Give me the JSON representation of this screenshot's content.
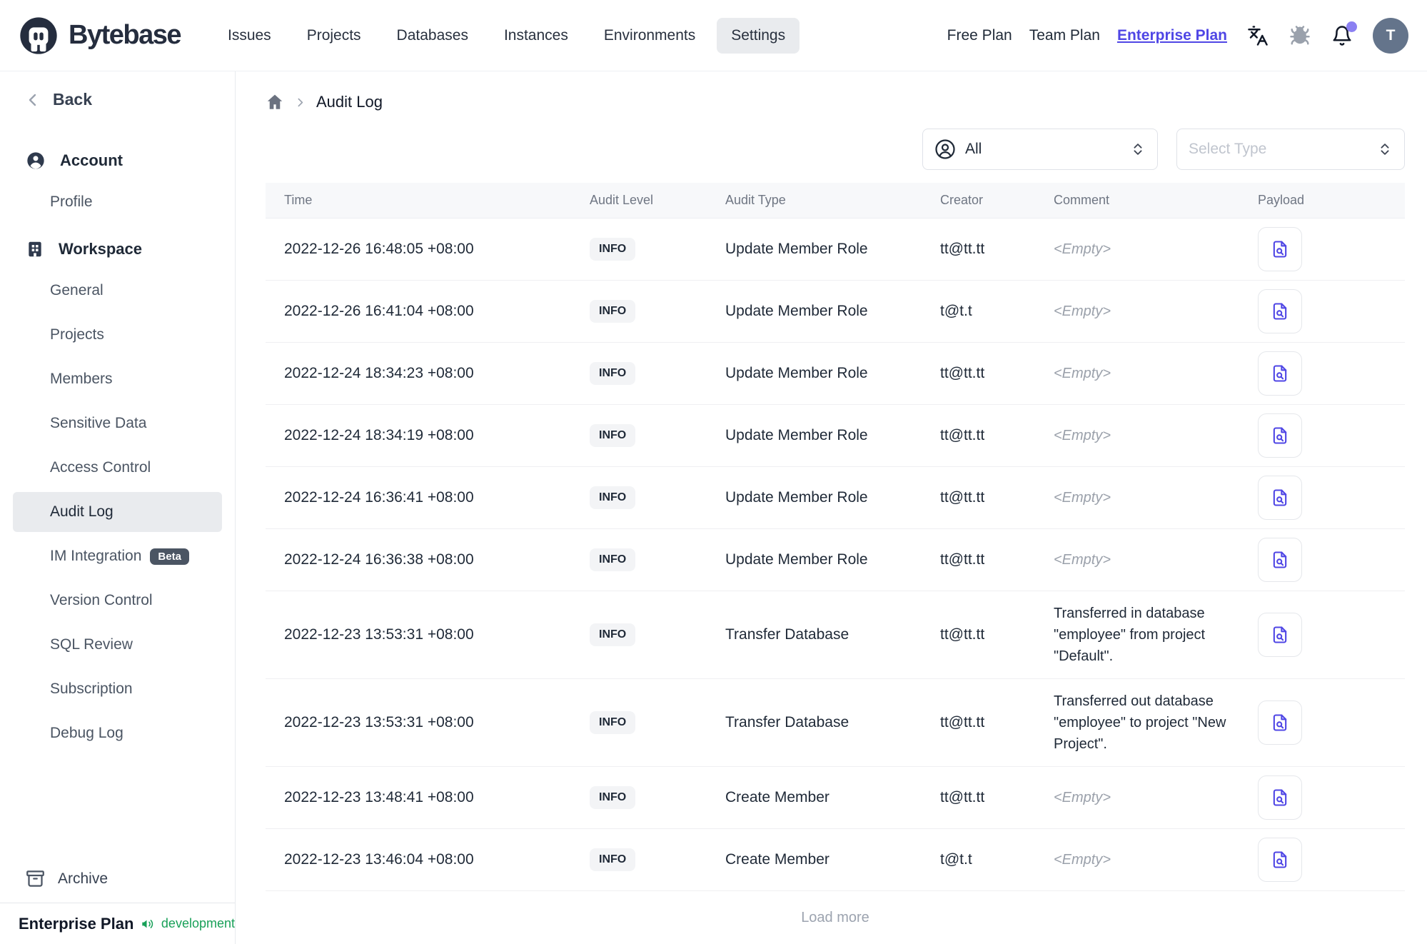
{
  "topbar": {
    "brand": "Bytebase",
    "nav_items": [
      {
        "label": "Issues",
        "active": false
      },
      {
        "label": "Projects",
        "active": false
      },
      {
        "label": "Databases",
        "active": false
      },
      {
        "label": "Instances",
        "active": false
      },
      {
        "label": "Environments",
        "active": false
      },
      {
        "label": "Settings",
        "active": true
      }
    ],
    "plan_links": [
      {
        "label": "Free Plan",
        "accent": false
      },
      {
        "label": "Team Plan",
        "accent": false
      },
      {
        "label": "Enterprise Plan",
        "accent": true
      }
    ],
    "bell_has_badge": true,
    "avatar_initial": "T"
  },
  "sidebar": {
    "back_label": "Back",
    "sections": [
      {
        "title": "Account",
        "icon": "user-circle-icon",
        "items": [
          {
            "label": "Profile"
          }
        ]
      },
      {
        "title": "Workspace",
        "icon": "building-icon",
        "items": [
          {
            "label": "General"
          },
          {
            "label": "Projects"
          },
          {
            "label": "Members"
          },
          {
            "label": "Sensitive Data"
          },
          {
            "label": "Access Control"
          },
          {
            "label": "Audit Log",
            "active": true
          },
          {
            "label": "IM Integration",
            "badge": "Beta"
          },
          {
            "label": "Version Control"
          },
          {
            "label": "SQL Review"
          },
          {
            "label": "Subscription"
          },
          {
            "label": "Debug Log"
          }
        ]
      }
    ],
    "archive_label": "Archive",
    "footer": {
      "plan_label": "Enterprise Plan",
      "environment": "development"
    }
  },
  "breadcrumb": {
    "current": "Audit Log"
  },
  "filters": {
    "creator_select": {
      "value": "All"
    },
    "type_select": {
      "placeholder": "Select Type"
    }
  },
  "audit_table": {
    "columns": [
      "Time",
      "Audit Level",
      "Audit Type",
      "Creator",
      "Comment",
      "Payload"
    ],
    "empty_comment": "<Empty>",
    "rows": [
      {
        "time": "2022-12-26 16:48:05 +08:00",
        "level": "INFO",
        "type": "Update Member Role",
        "creator": "tt@tt.tt",
        "comment": ""
      },
      {
        "time": "2022-12-26 16:41:04 +08:00",
        "level": "INFO",
        "type": "Update Member Role",
        "creator": "t@t.t",
        "comment": ""
      },
      {
        "time": "2022-12-24 18:34:23 +08:00",
        "level": "INFO",
        "type": "Update Member Role",
        "creator": "tt@tt.tt",
        "comment": ""
      },
      {
        "time": "2022-12-24 18:34:19 +08:00",
        "level": "INFO",
        "type": "Update Member Role",
        "creator": "tt@tt.tt",
        "comment": ""
      },
      {
        "time": "2022-12-24 16:36:41 +08:00",
        "level": "INFO",
        "type": "Update Member Role",
        "creator": "tt@tt.tt",
        "comment": ""
      },
      {
        "time": "2022-12-24 16:36:38 +08:00",
        "level": "INFO",
        "type": "Update Member Role",
        "creator": "tt@tt.tt",
        "comment": ""
      },
      {
        "time": "2022-12-23 13:53:31 +08:00",
        "level": "INFO",
        "type": "Transfer Database",
        "creator": "tt@tt.tt",
        "comment": "Transferred in database \"employee\" from project \"Default\"."
      },
      {
        "time": "2022-12-23 13:53:31 +08:00",
        "level": "INFO",
        "type": "Transfer Database",
        "creator": "tt@tt.tt",
        "comment": "Transferred out database \"employee\" to project \"New Project\"."
      },
      {
        "time": "2022-12-23 13:48:41 +08:00",
        "level": "INFO",
        "type": "Create Member",
        "creator": "tt@tt.tt",
        "comment": ""
      },
      {
        "time": "2022-12-23 13:46:04 +08:00",
        "level": "INFO",
        "type": "Create Member",
        "creator": "t@t.t",
        "comment": ""
      }
    ],
    "load_more_label": "Load more"
  },
  "colors": {
    "accent": "#4f46e5",
    "brand_navy": "#252d3e",
    "success_green": "#18a058",
    "notification_dot": "#8b80f2",
    "avatar_bg": "#64748b"
  }
}
